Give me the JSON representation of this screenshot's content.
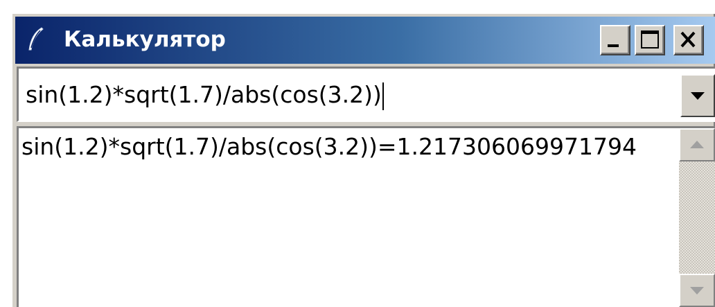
{
  "window": {
    "title": "Калькулятор",
    "title_icon": "feather-pen-icon",
    "controls": {
      "minimize_icon": "minimize-icon",
      "maximize_icon": "maximize-icon",
      "close_icon": "close-icon"
    }
  },
  "expression_input": {
    "value": "sin(1.2)*sqrt(1.7)/abs(cos(3.2))",
    "dropdown_icon": "chevron-down-icon"
  },
  "output": {
    "lines": [
      "sin(1.2)*sqrt(1.7)/abs(cos(3.2))=1.217306069971794"
    ],
    "scroll_up_icon": "scroll-up-icon",
    "scroll_down_icon": "scroll-down-icon"
  },
  "colors": {
    "titlebar_start": "#0a246a",
    "titlebar_end": "#a6caf0",
    "window_face": "#d4d0c8"
  }
}
